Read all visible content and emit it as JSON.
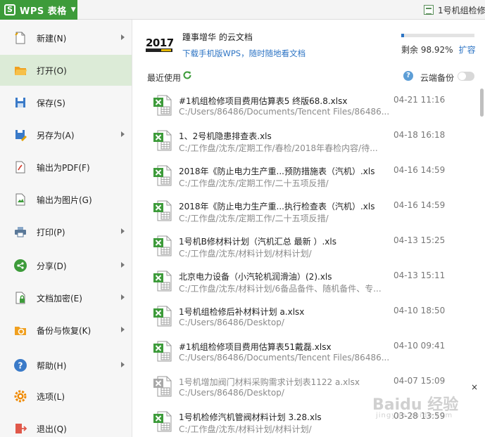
{
  "app": {
    "logo": "S",
    "title": "WPS 表格"
  },
  "doc_tab": "1号机组检修",
  "menu": [
    {
      "label": "新建(N)",
      "icon": "new-file-icon",
      "submenu": true
    },
    {
      "label": "打开(O)",
      "icon": "open-folder-icon",
      "submenu": false,
      "active": true
    },
    {
      "label": "保存(S)",
      "icon": "save-icon",
      "submenu": false
    },
    {
      "label": "另存为(A)",
      "icon": "save-as-icon",
      "submenu": true
    },
    {
      "label": "输出为PDF(F)",
      "icon": "pdf-icon",
      "submenu": false
    },
    {
      "label": "输出为图片(G)",
      "icon": "image-export-icon",
      "submenu": false
    },
    {
      "label": "打印(P)",
      "icon": "print-icon",
      "submenu": true
    },
    {
      "label": "分享(D)",
      "icon": "share-icon",
      "submenu": true
    },
    {
      "label": "文档加密(E)",
      "icon": "encrypt-icon",
      "submenu": true
    },
    {
      "label": "备份与恢复(K)",
      "icon": "backup-icon",
      "submenu": true
    },
    {
      "label": "帮助(H)",
      "icon": "help-icon",
      "submenu": true
    },
    {
      "label": "选项(L)",
      "icon": "gear-icon",
      "submenu": false
    },
    {
      "label": "退出(Q)",
      "icon": "exit-icon",
      "submenu": false
    }
  ],
  "cloud": {
    "badge_year": "2017",
    "user": "踵事增华",
    "user_suffix": " 的云文档",
    "download_link": "下载手机版WPS，随时随地看文档",
    "quota_fraction": 0.0108,
    "quota_label": "剩余 98.92%",
    "expand_link": "扩容"
  },
  "recent": {
    "title": "最近使用",
    "cloud_backup_label": "云端备份",
    "cloud_backup_on": false
  },
  "files": [
    {
      "name": "#1机组检修项目费用估算表5 终版68.8.xlsx",
      "path": "C:/Users/86486/Documents/Tencent Files/86486...",
      "time": "04-21 11:16"
    },
    {
      "name": "1、2号机隐患排查表.xls",
      "path": "C:/工作盘/沈东/定期工作/春检/2018年春检内容/待...",
      "time": "04-18 16:18"
    },
    {
      "name": "2018年《防止电力生产重...预防措施表（汽机）.xls",
      "path": "C:/工作盘/沈东/定期工作/二十五项反措/",
      "time": "04-16 14:59"
    },
    {
      "name": "2018年《防止电力生产重...执行检查表（汽机）.xls",
      "path": "C:/工作盘/沈东/定期工作/二十五项反措/",
      "time": "04-16 14:59"
    },
    {
      "name": "1号机B修材料计划（汽机汇总 最新 ）.xls",
      "path": "C:/工作盘/沈东/材料计划/材料计划/",
      "time": "04-13 15:25"
    },
    {
      "name": "北京电力设备（小汽轮机润滑油）(2).xls",
      "path": "C:/工作盘/沈东/材料计划/6备品备件、随机备件、专...",
      "time": "04-13 15:11"
    },
    {
      "name": "1号机组检修后补材料计划 a.xlsx",
      "path": "C:/Users/86486/Desktop/",
      "time": "04-10 18:50"
    },
    {
      "name": "#1机组检修项目费用估算表51戴磊.xlsx",
      "path": "C:/Users/86486/Documents/Tencent Files/86486...",
      "time": "04-10 09:41"
    },
    {
      "name": "1号机增加阀门材料采购需求计划表1122 a.xlsx",
      "path": "C:/Users/86486/Desktop/",
      "time": "04-07 15:09",
      "dim": true,
      "close": "×"
    },
    {
      "name": "1号机检修汽机管阀材料计划 3.28.xls",
      "path": "C:/工作盘/沈东/材料计划/材料计划/",
      "time": "03-28 13:59"
    }
  ],
  "watermark": {
    "main": "Baidu 经验",
    "sub": "jingyan.baidu.com"
  }
}
